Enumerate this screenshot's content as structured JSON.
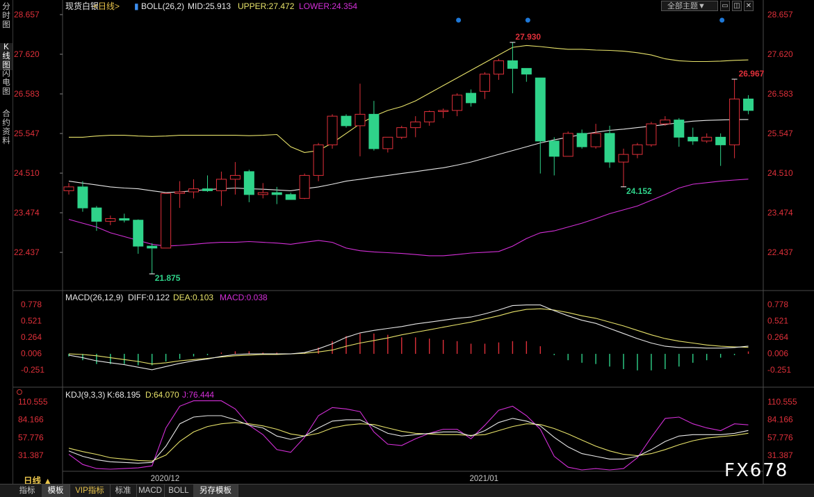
{
  "sidebar": {
    "tabs": [
      {
        "label": "分时图",
        "active": false
      },
      {
        "label": "K线图",
        "active": true
      },
      {
        "label": "闪电图",
        "active": false
      },
      {
        "label": "合约资料",
        "active": false
      }
    ]
  },
  "header": {
    "theme_button": "全部主题▼"
  },
  "main_panel": {
    "title": "现货白银",
    "period": "<日线>",
    "indicator": "BOLL(26,2)",
    "mid": "MID:25.913",
    "upper": "UPPER:27.472",
    "lower": "LOWER:24.354",
    "y_ticks": [
      "28.657",
      "27.620",
      "26.583",
      "25.547",
      "24.510",
      "23.474",
      "22.437"
    ],
    "annotations": {
      "high1": "27.930",
      "high2": "26.967",
      "low1": "21.875",
      "low2": "24.152"
    }
  },
  "macd_panel": {
    "title": "MACD(26,12,9)",
    "diff": "DIFF:0.122",
    "dea": "DEA:0.103",
    "macd": "MACD:0.038",
    "y_ticks": [
      "0.778",
      "0.521",
      "0.264",
      "0.006",
      "-0.251"
    ]
  },
  "kdj_panel": {
    "title": "KDJ(9,3,3)",
    "k": "K:68.195",
    "d": "D:64.070",
    "j": "J:76.444",
    "y_ticks": [
      "110.555",
      "84.166",
      "57.776",
      "31.387"
    ]
  },
  "x_axis": {
    "labels": [
      "2020/12",
      "2021/01"
    ]
  },
  "footer": {
    "period_label": "日线 ▲",
    "tabs": [
      {
        "label": "指标",
        "active": false,
        "vip": false
      },
      {
        "label": "模板",
        "active": true,
        "vip": false
      },
      {
        "label": "VIP指标",
        "active": false,
        "vip": true
      },
      {
        "label": "标准",
        "active": false,
        "vip": false
      },
      {
        "label": "MACD",
        "active": false,
        "vip": false
      },
      {
        "label": "BOLL",
        "active": false,
        "vip": false
      },
      {
        "label": "另存模板",
        "active": true,
        "vip": false
      }
    ]
  },
  "watermark": "FX678",
  "colors": {
    "up": "#e0303a",
    "down": "#2fd38a",
    "mid": "#e8e8e8",
    "upper": "#e8e36a",
    "lower": "#d42fd8",
    "label": "#e0303a"
  },
  "chart_data": {
    "type": "candlestick",
    "price_range": [
      21.875,
      28.657
    ],
    "candles": [
      {
        "o": 24.05,
        "h": 24.25,
        "l": 23.95,
        "c": 24.15
      },
      {
        "o": 24.15,
        "h": 24.3,
        "l": 23.5,
        "c": 23.6
      },
      {
        "o": 23.6,
        "h": 23.65,
        "l": 23.0,
        "c": 23.25
      },
      {
        "o": 23.25,
        "h": 23.4,
        "l": 23.15,
        "c": 23.32
      },
      {
        "o": 23.32,
        "h": 23.45,
        "l": 23.22,
        "c": 23.28
      },
      {
        "o": 23.28,
        "h": 23.3,
        "l": 22.4,
        "c": 22.6
      },
      {
        "o": 22.6,
        "h": 22.68,
        "l": 21.875,
        "c": 22.55
      },
      {
        "o": 22.55,
        "h": 24.0,
        "l": 22.55,
        "c": 23.98
      },
      {
        "o": 23.98,
        "h": 24.3,
        "l": 23.6,
        "c": 24.02
      },
      {
        "o": 24.02,
        "h": 24.35,
        "l": 23.85,
        "c": 24.1
      },
      {
        "o": 24.1,
        "h": 24.45,
        "l": 24.02,
        "c": 24.05
      },
      {
        "o": 24.05,
        "h": 24.55,
        "l": 23.65,
        "c": 24.35
      },
      {
        "o": 24.35,
        "h": 24.8,
        "l": 23.95,
        "c": 24.45
      },
      {
        "o": 24.55,
        "h": 24.6,
        "l": 23.75,
        "c": 23.95
      },
      {
        "o": 23.95,
        "h": 24.25,
        "l": 23.85,
        "c": 24.0
      },
      {
        "o": 24.0,
        "h": 24.15,
        "l": 23.7,
        "c": 23.95
      },
      {
        "o": 23.95,
        "h": 24.0,
        "l": 23.82,
        "c": 23.82
      },
      {
        "o": 23.85,
        "h": 24.5,
        "l": 23.83,
        "c": 24.45
      },
      {
        "o": 24.45,
        "h": 25.3,
        "l": 24.3,
        "c": 25.25
      },
      {
        "o": 25.25,
        "h": 26.05,
        "l": 25.15,
        "c": 26.0
      },
      {
        "o": 26.0,
        "h": 26.05,
        "l": 25.7,
        "c": 25.75
      },
      {
        "o": 25.75,
        "h": 26.85,
        "l": 24.95,
        "c": 26.05
      },
      {
        "o": 26.05,
        "h": 26.4,
        "l": 25.1,
        "c": 25.15
      },
      {
        "o": 25.15,
        "h": 25.45,
        "l": 25.05,
        "c": 25.45
      },
      {
        "o": 25.45,
        "h": 25.75,
        "l": 25.4,
        "c": 25.7
      },
      {
        "o": 25.7,
        "h": 26.0,
        "l": 25.45,
        "c": 25.85
      },
      {
        "o": 25.85,
        "h": 26.15,
        "l": 25.75,
        "c": 26.12
      },
      {
        "o": 26.12,
        "h": 26.2,
        "l": 25.95,
        "c": 26.15
      },
      {
        "o": 26.15,
        "h": 26.6,
        "l": 26.0,
        "c": 26.55
      },
      {
        "o": 26.6,
        "h": 26.7,
        "l": 26.25,
        "c": 26.35
      },
      {
        "o": 26.65,
        "h": 27.15,
        "l": 26.45,
        "c": 27.1
      },
      {
        "o": 27.1,
        "h": 27.5,
        "l": 26.95,
        "c": 27.45
      },
      {
        "o": 27.45,
        "h": 27.93,
        "l": 26.6,
        "c": 27.25
      },
      {
        "o": 27.25,
        "h": 27.25,
        "l": 26.9,
        "c": 27.1
      },
      {
        "o": 27.0,
        "h": 27.0,
        "l": 24.5,
        "c": 25.35
      },
      {
        "o": 25.35,
        "h": 25.45,
        "l": 24.45,
        "c": 24.95
      },
      {
        "o": 24.95,
        "h": 25.6,
        "l": 24.95,
        "c": 25.55
      },
      {
        "o": 25.55,
        "h": 25.65,
        "l": 25.15,
        "c": 25.2
      },
      {
        "o": 25.2,
        "h": 25.8,
        "l": 25.15,
        "c": 25.55
      },
      {
        "o": 25.55,
        "h": 25.75,
        "l": 24.65,
        "c": 24.8
      },
      {
        "o": 24.8,
        "h": 25.15,
        "l": 24.152,
        "c": 25.0
      },
      {
        "o": 25.0,
        "h": 25.3,
        "l": 24.9,
        "c": 25.25
      },
      {
        "o": 25.25,
        "h": 25.85,
        "l": 25.2,
        "c": 25.8
      },
      {
        "o": 25.8,
        "h": 26.0,
        "l": 25.75,
        "c": 25.9
      },
      {
        "o": 25.9,
        "h": 25.95,
        "l": 25.2,
        "c": 25.45
      },
      {
        "o": 25.45,
        "h": 25.7,
        "l": 25.25,
        "c": 25.35
      },
      {
        "o": 25.35,
        "h": 25.55,
        "l": 25.3,
        "c": 25.45
      },
      {
        "o": 25.45,
        "h": 25.55,
        "l": 24.7,
        "c": 25.25
      },
      {
        "o": 25.25,
        "h": 26.967,
        "l": 24.9,
        "c": 26.45
      },
      {
        "o": 26.45,
        "h": 26.55,
        "l": 26.05,
        "c": 26.15
      }
    ],
    "boll_mid": [
      24.3,
      24.25,
      24.2,
      24.15,
      24.12,
      24.1,
      24.05,
      24.0,
      24.02,
      24.05,
      24.08,
      24.1,
      24.12,
      24.1,
      24.09,
      24.07,
      24.05,
      24.1,
      24.15,
      24.22,
      24.3,
      24.35,
      24.4,
      24.45,
      24.5,
      24.55,
      24.6,
      24.65,
      24.72,
      24.8,
      24.9,
      25.0,
      25.1,
      25.2,
      25.3,
      25.38,
      25.45,
      25.52,
      25.58,
      25.63,
      25.66,
      25.7,
      25.74,
      25.78,
      25.83,
      25.87,
      25.89,
      25.9,
      25.91,
      25.913
    ],
    "boll_upper": [
      25.45,
      25.45,
      25.48,
      25.5,
      25.5,
      25.48,
      25.47,
      25.48,
      25.5,
      25.5,
      25.5,
      25.5,
      25.5,
      25.49,
      25.5,
      25.52,
      25.2,
      25.05,
      25.1,
      25.3,
      25.55,
      25.8,
      26.0,
      26.15,
      26.25,
      26.4,
      26.6,
      26.8,
      27.0,
      27.2,
      27.4,
      27.6,
      27.8,
      27.85,
      27.82,
      27.78,
      27.75,
      27.75,
      27.73,
      27.72,
      27.7,
      27.66,
      27.6,
      27.5,
      27.45,
      27.43,
      27.43,
      27.44,
      27.46,
      27.472
    ],
    "boll_lower": [
      23.3,
      23.2,
      23.1,
      22.95,
      22.85,
      22.75,
      22.65,
      22.6,
      22.62,
      22.65,
      22.68,
      22.7,
      22.7,
      22.72,
      22.7,
      22.68,
      22.65,
      22.7,
      22.75,
      22.7,
      22.55,
      22.48,
      22.45,
      22.43,
      22.41,
      22.38,
      22.35,
      22.35,
      22.38,
      22.42,
      22.44,
      22.46,
      22.6,
      22.8,
      22.95,
      23.0,
      23.1,
      23.2,
      23.32,
      23.45,
      23.55,
      23.65,
      23.8,
      23.95,
      24.12,
      24.22,
      24.26,
      24.3,
      24.33,
      24.354
    ],
    "macd": {
      "range": [
        -0.251,
        0.778
      ],
      "diff": [
        -0.02,
        -0.06,
        -0.11,
        -0.14,
        -0.17,
        -0.21,
        -0.25,
        -0.2,
        -0.15,
        -0.11,
        -0.08,
        -0.04,
        -0.01,
        0.0,
        0.0,
        0.0,
        0.0,
        0.02,
        0.08,
        0.16,
        0.26,
        0.33,
        0.37,
        0.4,
        0.43,
        0.47,
        0.5,
        0.53,
        0.56,
        0.58,
        0.63,
        0.69,
        0.76,
        0.77,
        0.77,
        0.68,
        0.6,
        0.53,
        0.48,
        0.4,
        0.32,
        0.24,
        0.17,
        0.12,
        0.1,
        0.1,
        0.09,
        0.09,
        0.1,
        0.122
      ],
      "dea": [
        0.0,
        -0.01,
        -0.03,
        -0.06,
        -0.09,
        -0.12,
        -0.16,
        -0.14,
        -0.11,
        -0.09,
        -0.07,
        -0.05,
        -0.03,
        -0.02,
        -0.01,
        -0.01,
        0.0,
        0.01,
        0.03,
        0.06,
        0.12,
        0.17,
        0.21,
        0.25,
        0.3,
        0.34,
        0.38,
        0.42,
        0.46,
        0.5,
        0.55,
        0.6,
        0.66,
        0.7,
        0.71,
        0.69,
        0.65,
        0.6,
        0.56,
        0.5,
        0.44,
        0.37,
        0.3,
        0.24,
        0.2,
        0.17,
        0.14,
        0.12,
        0.11,
        0.103
      ],
      "hist": [
        -0.04,
        -0.1,
        -0.16,
        -0.16,
        -0.16,
        -0.18,
        -0.18,
        -0.12,
        -0.08,
        -0.04,
        -0.02,
        0.02,
        0.04,
        0.04,
        0.02,
        0.02,
        0.0,
        0.02,
        0.1,
        0.2,
        0.28,
        0.32,
        0.32,
        0.3,
        0.26,
        0.26,
        0.24,
        0.22,
        0.2,
        0.16,
        0.16,
        0.18,
        0.2,
        0.2,
        0.12,
        -0.02,
        -0.1,
        -0.14,
        -0.16,
        -0.2,
        -0.24,
        -0.26,
        -0.26,
        -0.24,
        -0.2,
        -0.14,
        -0.1,
        -0.06,
        -0.02,
        0.038
      ]
    },
    "kdj": {
      "range": [
        10,
        110.555
      ],
      "k": [
        38,
        30,
        25,
        22,
        21,
        20,
        21,
        45,
        78,
        88,
        90,
        90,
        84,
        76,
        72,
        60,
        55,
        60,
        72,
        82,
        84,
        84,
        74,
        64,
        60,
        62,
        64,
        66,
        66,
        60,
        68,
        80,
        86,
        82,
        75,
        58,
        44,
        34,
        30,
        26,
        26,
        30,
        40,
        52,
        60,
        62,
        62,
        62,
        64,
        68.195
      ],
      "d": [
        42,
        37,
        33,
        28,
        26,
        24,
        23,
        32,
        52,
        66,
        74,
        78,
        80,
        78,
        75,
        70,
        63,
        60,
        64,
        72,
        76,
        78,
        77,
        72,
        67,
        64,
        63,
        62,
        62,
        61,
        62,
        68,
        74,
        78,
        77,
        71,
        63,
        54,
        45,
        38,
        33,
        31,
        34,
        40,
        47,
        53,
        57,
        59,
        61,
        64.07
      ],
      "j": [
        33,
        18,
        12,
        11,
        12,
        13,
        16,
        72,
        104,
        112,
        112,
        112,
        100,
        76,
        62,
        40,
        36,
        58,
        90,
        102,
        100,
        96,
        66,
        48,
        46,
        56,
        64,
        70,
        70,
        56,
        76,
        98,
        104,
        90,
        70,
        30,
        14,
        10,
        12,
        10,
        12,
        28,
        58,
        86,
        88,
        78,
        72,
        68,
        78,
        76.444
      ]
    },
    "x_labels": [
      {
        "label": "2020/12",
        "index": 7
      },
      {
        "label": "2021/01",
        "index": 30
      }
    ]
  }
}
